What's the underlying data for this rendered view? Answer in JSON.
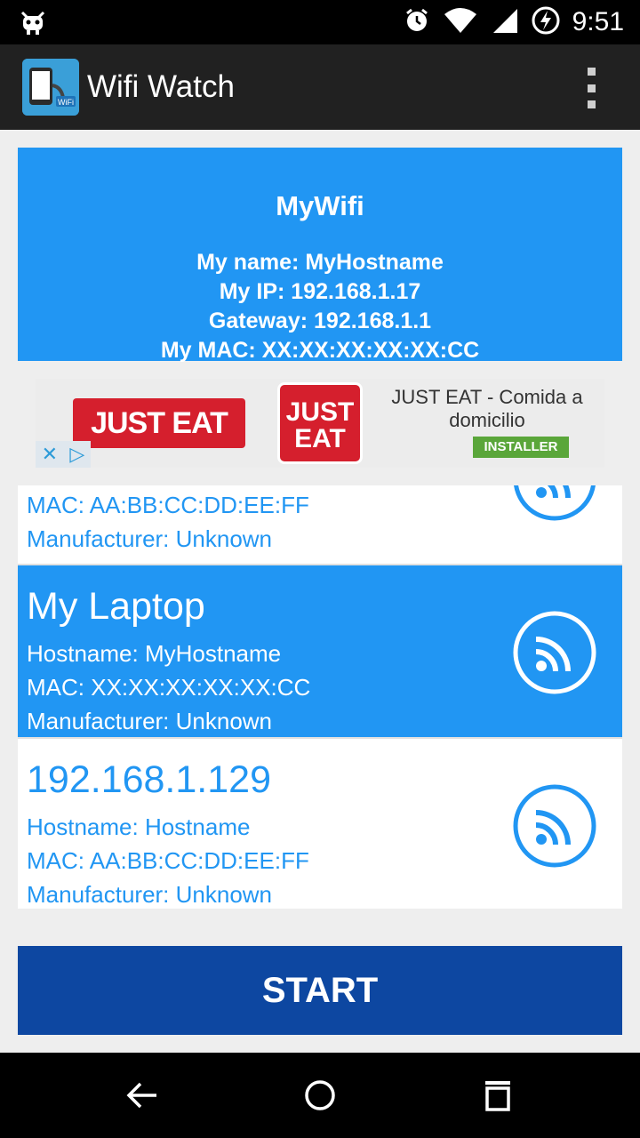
{
  "status_bar": {
    "time": "9:51",
    "icons": [
      "debug-android-icon",
      "alarm-icon",
      "wifi-icon",
      "signal-icon",
      "battery-charging-icon"
    ]
  },
  "app_bar": {
    "title": "Wifi Watch",
    "icon_badge": "WiFi"
  },
  "network": {
    "ssid": "MyWifi",
    "my_name": "My name: MyHostname",
    "my_ip": "My IP: 192.168.1.17",
    "gateway": "Gateway: 192.168.1.1",
    "my_mac": "My MAC: XX:XX:XX:XX:XX:CC"
  },
  "ad": {
    "banner_text": "JUST EAT",
    "logo_line1": "JUST",
    "logo_line2": "EAT",
    "title": "JUST EAT - Comida a domicilio",
    "install_label": "INSTALLER"
  },
  "devices": [
    {
      "mac": "MAC: AA:BB:CC:DD:EE:FF",
      "manufacturer": "Manufacturer: Unknown"
    },
    {
      "name": "My Laptop",
      "hostname": "Hostname: MyHostname",
      "mac": "MAC: XX:XX:XX:XX:XX:CC",
      "manufacturer": "Manufacturer: Unknown"
    },
    {
      "name": "192.168.1.129",
      "hostname": "Hostname: Hostname",
      "mac": "MAC: AA:BB:CC:DD:EE:FF",
      "manufacturer": "Manufacturer: Unknown"
    }
  ],
  "start_label": "START",
  "colors": {
    "primary": "#2196F3",
    "primary_dark": "#0D47A1",
    "app_bar": "#212121",
    "ad_red": "#d51f2d",
    "install_green": "#5aa63a"
  }
}
